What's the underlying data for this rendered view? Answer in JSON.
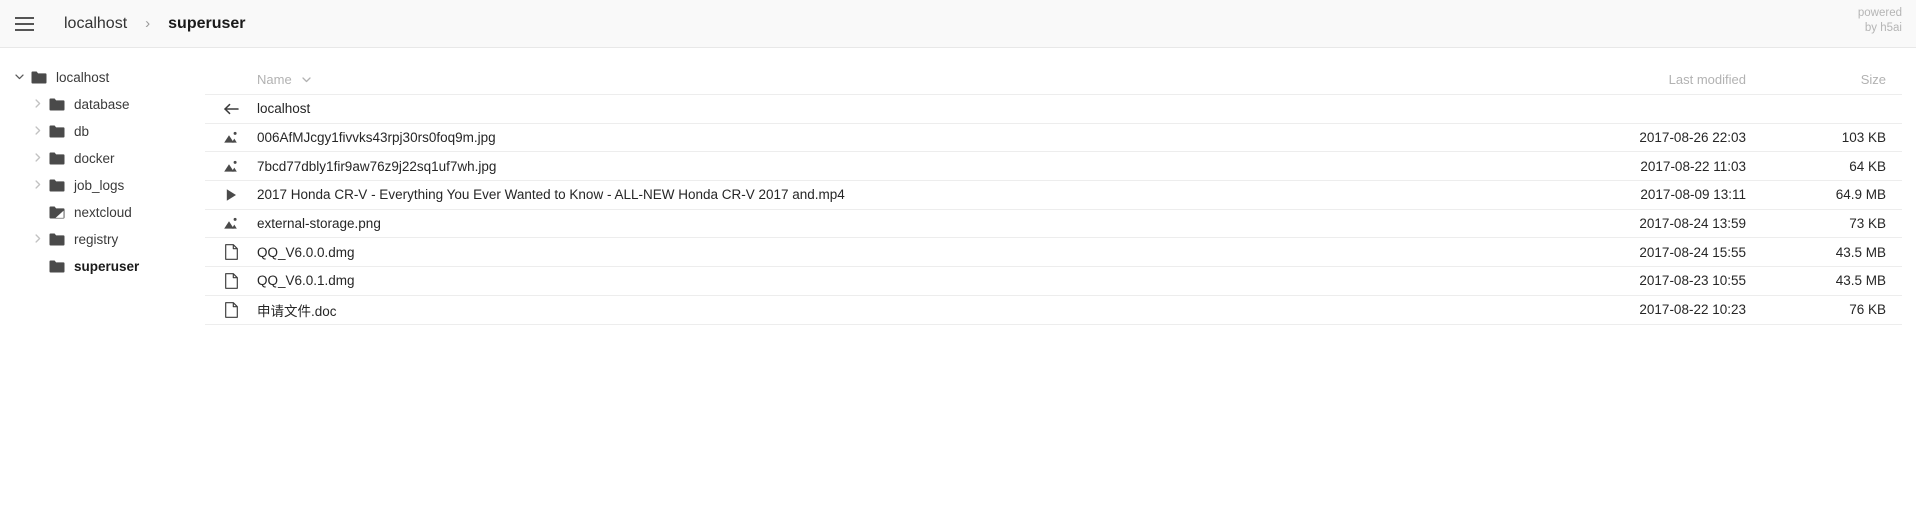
{
  "header": {
    "menu_icon": "hamburger-menu-icon",
    "breadcrumb": [
      {
        "label": "localhost",
        "current": false
      },
      {
        "label": "superuser",
        "current": true
      }
    ],
    "separator": "›",
    "powered_line1": "powered",
    "powered_line2": "by h5ai"
  },
  "sidebar": {
    "items": [
      {
        "label": "localhost",
        "indent": 0,
        "twisty": "chevron-down",
        "icon": "folder",
        "active": false
      },
      {
        "label": "database",
        "indent": 1,
        "twisty": "chevron-right",
        "icon": "folder",
        "active": false
      },
      {
        "label": "db",
        "indent": 1,
        "twisty": "chevron-right",
        "icon": "folder",
        "active": false
      },
      {
        "label": "docker",
        "indent": 1,
        "twisty": "chevron-right",
        "icon": "folder",
        "active": false
      },
      {
        "label": "job_logs",
        "indent": 1,
        "twisty": "chevron-right",
        "icon": "folder",
        "active": false
      },
      {
        "label": "nextcloud",
        "indent": 1,
        "twisty": "none",
        "icon": "folder-link",
        "active": false
      },
      {
        "label": "registry",
        "indent": 1,
        "twisty": "chevron-right",
        "icon": "folder",
        "active": false
      },
      {
        "label": "superuser",
        "indent": 1,
        "twisty": "none",
        "icon": "folder",
        "active": true
      }
    ]
  },
  "main": {
    "columns": {
      "name": "Name",
      "name_sort_icon": "chevron-down-icon",
      "last_modified": "Last modified",
      "size": "Size"
    },
    "rows": [
      {
        "icon": "arrow-left-icon",
        "name": "localhost",
        "date": "",
        "size": "",
        "parent": true
      },
      {
        "icon": "image-icon",
        "name": "006AfMJcgy1fivvks43rpj30rs0foq9m.jpg",
        "date": "2017-08-26 22:03",
        "size": "103 KB",
        "parent": false
      },
      {
        "icon": "image-icon",
        "name": "7bcd77dbly1fir9aw76z9j22sq1uf7wh.jpg",
        "date": "2017-08-22 11:03",
        "size": "64 KB",
        "parent": false
      },
      {
        "icon": "video-icon",
        "name": "2017 Honda CR-V - Everything You Ever Wanted to Know - ALL-NEW Honda CR-V 2017 and.mp4",
        "date": "2017-08-09 13:11",
        "size": "64.9 MB",
        "parent": false
      },
      {
        "icon": "image-icon",
        "name": "external-storage.png",
        "date": "2017-08-24 13:59",
        "size": "73 KB",
        "parent": false
      },
      {
        "icon": "file-icon",
        "name": "QQ_V6.0.0.dmg",
        "date": "2017-08-24 15:55",
        "size": "43.5 MB",
        "parent": false
      },
      {
        "icon": "file-icon",
        "name": "QQ_V6.0.1.dmg",
        "date": "2017-08-23 10:55",
        "size": "43.5 MB",
        "parent": false
      },
      {
        "icon": "file-icon",
        "name": "申请文件.doc",
        "date": "2017-08-22 10:23",
        "size": "76 KB",
        "parent": false
      }
    ]
  },
  "colors": {
    "header_bg": "#f9f9f9",
    "header_border": "#e8e8e8",
    "text": "#262626",
    "muted": "#b2b2b2",
    "row_border": "#ededed",
    "icon": "#4a4a4a"
  }
}
